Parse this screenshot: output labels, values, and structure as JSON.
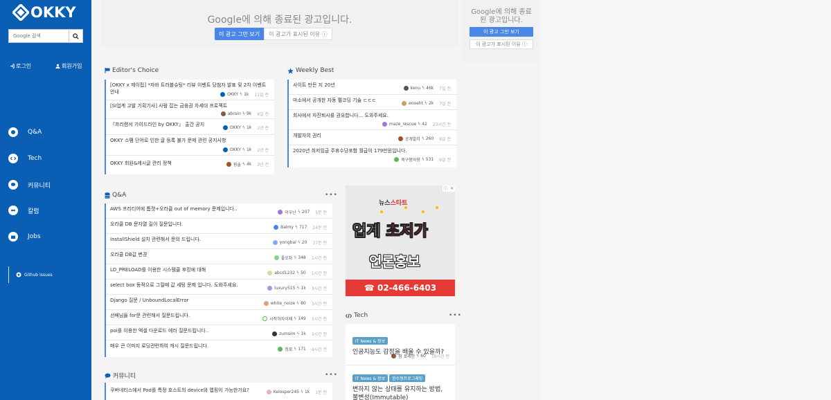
{
  "brand": {
    "name": "OKKY"
  },
  "search": {
    "placeholder": "Google 검색"
  },
  "auth": {
    "login": "로그인",
    "signup": "회원가입"
  },
  "nav": [
    {
      "label": "Q&A"
    },
    {
      "label": "Tech"
    },
    {
      "label": "커뮤니티"
    },
    {
      "label": "칼럼"
    },
    {
      "label": "Jobs"
    }
  ],
  "github": {
    "label": "Github Issues"
  },
  "ad_top": {
    "message_brand": "Google",
    "message": "에 의해 종료된 광고입니다.",
    "stop": "이 광고 그만 보기",
    "why": "이 광고가 표시된 이유 ⓘ"
  },
  "ad_right": {
    "message_brand": "Google",
    "message": "에 의해 종료된 광고입니다.",
    "stop": "이 광고 그만 보기",
    "why": "이 광고가 표시된 이유 ⓘ"
  },
  "editors_choice": {
    "title": "Editor's Choice",
    "items": [
      {
        "title": "[OKKY x 제이펍] *자바 트러블슈팅* 리뷰 이벤트 당첨자 발표 및 2차 이벤트 안내",
        "user": "OKKY",
        "score": "1k",
        "time": "11일 전"
      },
      {
        "title": "[SI업계 고발 기획기사] 사람 잡는 금융권 차세대 프로젝트",
        "user": "abrain",
        "score": "9k",
        "time": "8일 전"
      },
      {
        "title": "『프리랜서 가이드라인 by OKKY』 출간 공지",
        "user": "OKKY",
        "score": "1k",
        "time": "1년 전"
      },
      {
        "title": "OKKY 스팸 단어로 인한 글 등록 불가 문제 관련 공지사항",
        "user": "OKKY",
        "score": "1k",
        "time": "2년 전"
      },
      {
        "title": "OKKY 회원&게시글 관리 정책",
        "user": "핑솔",
        "score": "4k",
        "time": "3년 전"
      }
    ]
  },
  "weekly_best": {
    "title": "Weekly Best",
    "items": [
      {
        "title": "사이트 만든 지 20년",
        "user": "kenu",
        "score": "46k",
        "time": "7일 전"
      },
      {
        "title": "마소에서 공개한 자동 펠코딩 기술 ㄷㄷㄷ",
        "user": "enoeht",
        "score": "2k",
        "time": "7일 전"
      },
      {
        "title": "회사에서 자진퇴사를 권유합니다... 도와주세요.",
        "user": "maze_rescue",
        "score": "42",
        "time": "23시간 전"
      },
      {
        "title": "개발자의 권리",
        "user": "공개발자",
        "score": "260",
        "time": "6일 전"
      },
      {
        "title": "2020년 최저임금 주휴수당포함 월급이 179만원입니다.",
        "user": "죽구붕아향",
        "score": "531",
        "time": "6일 전"
      }
    ]
  },
  "qna": {
    "title": "Q&A",
    "more": "•••",
    "items": [
      {
        "title": "AWS 프리티어에 톰캣+오라클 out of memory 문제입니다..",
        "user": "이우난",
        "score": "207",
        "time": "5분 전"
      },
      {
        "title": "오라클 DB 문자열 길이 질문입니다.",
        "user": "Balmy",
        "score": "717",
        "time": "24분 전"
      },
      {
        "title": "InstallShield 설치 관련해서 문의 드립니다.",
        "user": "yongbal",
        "score": "20",
        "time": "37분 전"
      },
      {
        "title": "오라클 DB값 변경",
        "user": "좋오자",
        "score": "348",
        "time": "1시간 전"
      },
      {
        "title": "LD_PRELOAD를 이용한 시스템콜 후킹에 대해",
        "user": "abcd1232",
        "score": "50",
        "time": "1시간 전"
      },
      {
        "title": "select box 동적으로 그릴때 값 세팅 문제 입니다. 도와주세요.",
        "user": "luxury515",
        "score": "1k",
        "time": "3시간 전"
      },
      {
        "title": "Django 질문 / UnboundLocalError",
        "user": "white_noize",
        "score": "80",
        "time": "3시간 전"
      },
      {
        "title": "선배님들 for문 관련해서 질문드립니다.",
        "user": "시작하자이제",
        "score": "149",
        "time": "3시간 전"
      },
      {
        "title": "poi를 이용한 엑셀 다운로드 에러 질문드립니다..",
        "user": "zumsim",
        "score": "1k",
        "time": "3시간 전"
      },
      {
        "title": "매우 큰 이미지 로딩관련하여 캐시 질문드립니다.",
        "user": "정포",
        "score": "171",
        "time": "4시간 전"
      }
    ]
  },
  "community": {
    "title": "커뮤니티",
    "more": "•••",
    "items": [
      {
        "title": "쿠버네티스에서 Pod를 특정 호스트의 device와 맵핑이 가능한가요?",
        "user": "Kelosper245",
        "score": "1k",
        "time": "1분 전"
      }
    ]
  },
  "ad_box": {
    "brand_prefix": "뉴스",
    "brand_highlight": "스타트",
    "line1_a": "업계 ",
    "line1_b": "초저가",
    "line2": "언론홍보",
    "phone": "☎ 02-466-6403"
  },
  "tech": {
    "title": "Tech",
    "more": "•••",
    "items": [
      {
        "badges": [
          "IT News & 정보"
        ],
        "title": "인공지능도 감정을 배울 수 있을까?",
        "user": "잠 포레안",
        "score": "60",
        "time": "19시간 전"
      },
      {
        "badges": [
          "IT News & 정보",
          "함수형프로그래밍"
        ],
        "title": "변하지 않는 상태를 유지하는 방법, 불변성(Immutable)",
        "user": "",
        "score": "",
        "time": ""
      }
    ]
  },
  "colors": {
    "sidebar": "#0a5fb4",
    "accent": "#4a86e8",
    "ad_red": "#e53935"
  }
}
